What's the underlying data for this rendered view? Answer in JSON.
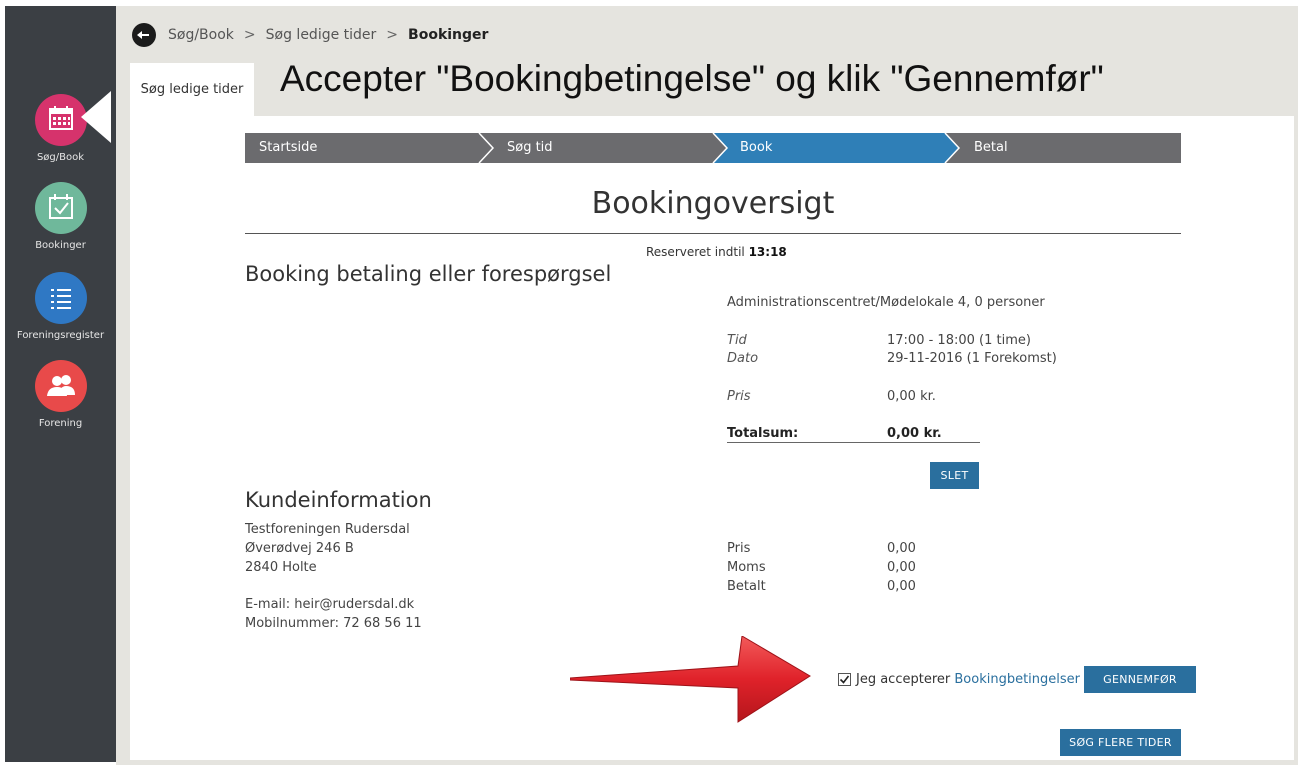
{
  "sidebar": {
    "items": [
      {
        "label": "Søg/Book",
        "color": "#d6336c",
        "icon": "calendar-grid-icon"
      },
      {
        "label": "Bookinger",
        "color": "#6fb89b",
        "icon": "calendar-check-icon"
      },
      {
        "label": "Foreningsregister",
        "color": "#2f78c4",
        "icon": "list-icon"
      },
      {
        "label": "Forening",
        "color": "#e84a4a",
        "icon": "people-icon"
      }
    ]
  },
  "breadcrumb": {
    "items": [
      "Søg/Book",
      "Søg ledige tider",
      "Bookinger"
    ],
    "separator": ">"
  },
  "tab": {
    "label": "Søg ledige tider"
  },
  "headline": "Accepter \"Bookingbetingelse\" og klik \"Gennemfør\"",
  "steps": [
    {
      "label": "Startside",
      "active": false
    },
    {
      "label": "Søg tid",
      "active": false
    },
    {
      "label": "Book",
      "active": true
    },
    {
      "label": "Betal",
      "active": false
    }
  ],
  "colors": {
    "step_gray": "#6b6b6e",
    "step_active": "#2f7fb7",
    "button_blue": "#2a6f9e",
    "arrow_red": "#e0222a"
  },
  "page_title": "Bookingoversigt",
  "reserved": {
    "label": "Reserveret indtil",
    "time": "13:18"
  },
  "booking": {
    "heading": "Booking betaling eller forespørgsel",
    "location": "Administrationscentret/Mødelokale 4, 0 personer",
    "tid_label": "Tid",
    "tid_value": "17:00 - 18:00 (1 time)",
    "dato_label": "Dato",
    "dato_value": "29-11-2016 (1 Forekomst)",
    "pris_label": "Pris",
    "pris_value": "0,00 kr.",
    "total_label": "Totalsum:",
    "total_value": "0,00 kr.",
    "delete_label": "SLET"
  },
  "customer": {
    "heading": "Kundeinformation",
    "name": "Testforeningen Rudersdal",
    "street": "Øverødvej 246 B",
    "city": "2840 Holte",
    "email": "E-mail: heir@rudersdal.dk",
    "phone": "Mobilnummer: 72 68 56 11",
    "pris_label": "Pris",
    "pris_value": "0,00",
    "moms_label": "Moms",
    "moms_value": "0,00",
    "betalt_label": "Betalt",
    "betalt_value": "0,00"
  },
  "accept": {
    "checked": true,
    "text": "Jeg accepterer",
    "link": "Bookingbetingelser",
    "submit_label": "GENNEMFØR"
  },
  "search_more_label": "SØG FLERE TIDER"
}
